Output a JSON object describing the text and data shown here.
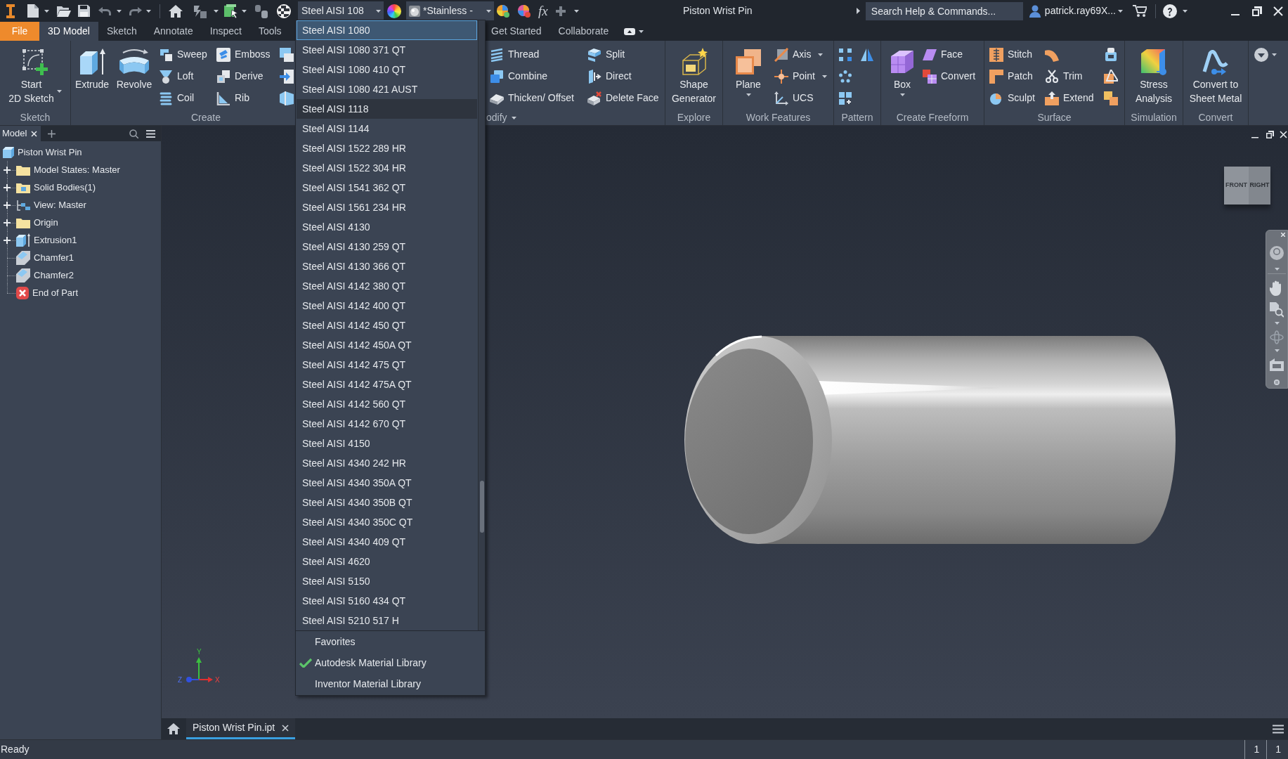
{
  "title_bar": {
    "material": "Steel AISI 108",
    "appearance": "*Stainless -",
    "function_symbol": "fx",
    "title": "Piston Wrist Pin",
    "search": {
      "placeholder": "Search Help & Commands..."
    },
    "user": "patrick.ray69X..."
  },
  "ribbon": {
    "file_tab": "File",
    "tabs": [
      {
        "label": "3D Model",
        "selected": true
      },
      {
        "label": "Sketch",
        "selected": false
      },
      {
        "label": "Annotate",
        "selected": false
      },
      {
        "label": "Inspect",
        "selected": false
      },
      {
        "label": "Tools",
        "selected": false
      }
    ],
    "tabs_right": [
      {
        "label": "Get Started",
        "selected": false
      },
      {
        "label": "Collaborate",
        "selected": false
      }
    ],
    "panels": [
      {
        "label": "Sketch",
        "has_menu": false,
        "buttons": [
          "Start\n2D Sketch"
        ]
      },
      {
        "label": "Create",
        "has_menu": false,
        "buttons": [
          "Extrude",
          "Revolve",
          "Sweep",
          "Loft",
          "Coil",
          "Emboss",
          "Derive",
          "Rib"
        ]
      },
      {
        "label": "odify",
        "has_menu": true,
        "buttons": [
          "Thread",
          "Combine",
          "Thicken/ Offset",
          "Split",
          "Direct",
          "Delete Face"
        ]
      },
      {
        "label": "Explore",
        "has_menu": false,
        "buttons": [
          "Shape\nGenerator"
        ]
      },
      {
        "label": "Work Features",
        "has_menu": false,
        "buttons": [
          "Plane",
          "Axis",
          "Point",
          "UCS"
        ]
      },
      {
        "label": "Pattern",
        "has_menu": false
      },
      {
        "label": "Create Freeform",
        "has_menu": false,
        "buttons": [
          "Box",
          "Face",
          "Convert"
        ]
      },
      {
        "label": "Surface",
        "has_menu": false,
        "buttons": [
          "Stitch",
          "Patch",
          "Sculpt",
          "Trim",
          "Extend"
        ]
      },
      {
        "label": "Simulation",
        "has_menu": false,
        "buttons": [
          "Stress\nAnalysis"
        ]
      },
      {
        "label": "Convert",
        "has_menu": false,
        "buttons": [
          "Convert to\nSheet Metal"
        ]
      }
    ]
  },
  "browser": {
    "tab": "Model",
    "tree": {
      "label": "Piston Wrist Pin",
      "kind": "part",
      "children": [
        {
          "label": "Model States: Master",
          "kind": "folder",
          "expandable": true
        },
        {
          "label": "Solid Bodies(1)",
          "kind": "bodies",
          "expandable": true
        },
        {
          "label": "View: Master",
          "kind": "view",
          "expandable": true
        },
        {
          "label": "Origin",
          "kind": "folder",
          "expandable": true
        },
        {
          "label": "Extrusion1",
          "kind": "extrusion",
          "expandable": true
        },
        {
          "label": "Chamfer1",
          "kind": "chamfer",
          "expandable": false
        },
        {
          "label": "Chamfer2",
          "kind": "chamfer",
          "expandable": false
        },
        {
          "label": "End of Part",
          "kind": "end",
          "expandable": false
        }
      ]
    }
  },
  "material_menu": {
    "items": [
      {
        "label": "Steel AISI 1080",
        "selected": true,
        "hovered": false
      },
      {
        "label": "Steel AISI 1080 371 QT",
        "selected": false,
        "hovered": false
      },
      {
        "label": "Steel AISI 1080 410 QT",
        "selected": false,
        "hovered": false
      },
      {
        "label": "Steel AISI 1080 421 AUST",
        "selected": false,
        "hovered": false
      },
      {
        "label": "Steel AISI 1118",
        "selected": false,
        "hovered": true
      },
      {
        "label": "Steel AISI 1144",
        "selected": false,
        "hovered": false
      },
      {
        "label": "Steel AISI 1522 289 HR",
        "selected": false,
        "hovered": false
      },
      {
        "label": "Steel AISI 1522 304 HR",
        "selected": false,
        "hovered": false
      },
      {
        "label": "Steel AISI 1541 362 QT",
        "selected": false,
        "hovered": false
      },
      {
        "label": "Steel AISI 1561 234 HR",
        "selected": false,
        "hovered": false
      },
      {
        "label": "Steel AISI 4130",
        "selected": false,
        "hovered": false
      },
      {
        "label": "Steel AISI 4130 259 QT",
        "selected": false,
        "hovered": false
      },
      {
        "label": "Steel AISI 4130 366 QT",
        "selected": false,
        "hovered": false
      },
      {
        "label": "Steel AISI 4142 380 QT",
        "selected": false,
        "hovered": false
      },
      {
        "label": "Steel AISI 4142 400 QT",
        "selected": false,
        "hovered": false
      },
      {
        "label": "Steel AISI 4142 450 QT",
        "selected": false,
        "hovered": false
      },
      {
        "label": "Steel AISI 4142 450A QT",
        "selected": false,
        "hovered": false
      },
      {
        "label": "Steel AISI 4142 475 QT",
        "selected": false,
        "hovered": false
      },
      {
        "label": "Steel AISI 4142 475A QT",
        "selected": false,
        "hovered": false
      },
      {
        "label": "Steel AISI 4142 560 QT",
        "selected": false,
        "hovered": false
      },
      {
        "label": "Steel AISI 4142 670 QT",
        "selected": false,
        "hovered": false
      },
      {
        "label": "Steel AISI 4150",
        "selected": false,
        "hovered": false
      },
      {
        "label": "Steel AISI 4340 242 HR",
        "selected": false,
        "hovered": false
      },
      {
        "label": "Steel AISI 4340 350A QT",
        "selected": false,
        "hovered": false
      },
      {
        "label": "Steel AISI 4340 350B QT",
        "selected": false,
        "hovered": false
      },
      {
        "label": "Steel AISI 4340 350C QT",
        "selected": false,
        "hovered": false
      },
      {
        "label": "Steel AISI 4340 409 QT",
        "selected": false,
        "hovered": false
      },
      {
        "label": "Steel AISI 4620",
        "selected": false,
        "hovered": false
      },
      {
        "label": "Steel AISI 5150",
        "selected": false,
        "hovered": false
      },
      {
        "label": "Steel AISI 5160 434 QT",
        "selected": false,
        "hovered": false
      },
      {
        "label": "Steel AISI 5210 517 H",
        "selected": false,
        "hovered": false
      }
    ],
    "libraries": [
      {
        "label": "Favorites",
        "checked": false
      },
      {
        "label": "Autodesk Material Library",
        "checked": true
      },
      {
        "label": "Inventor Material Library",
        "checked": false
      }
    ]
  },
  "viewport": {
    "view_cube": {
      "faces": [
        "FRONT",
        "RIGHT"
      ]
    },
    "axis_labels": [
      "Y",
      "Z",
      "X"
    ]
  },
  "document_tabs": [
    {
      "label": "Piston Wrist Pin.ipt",
      "selected": true
    }
  ],
  "status_bar": {
    "text": "Ready",
    "counters": [
      "1",
      "1"
    ]
  }
}
